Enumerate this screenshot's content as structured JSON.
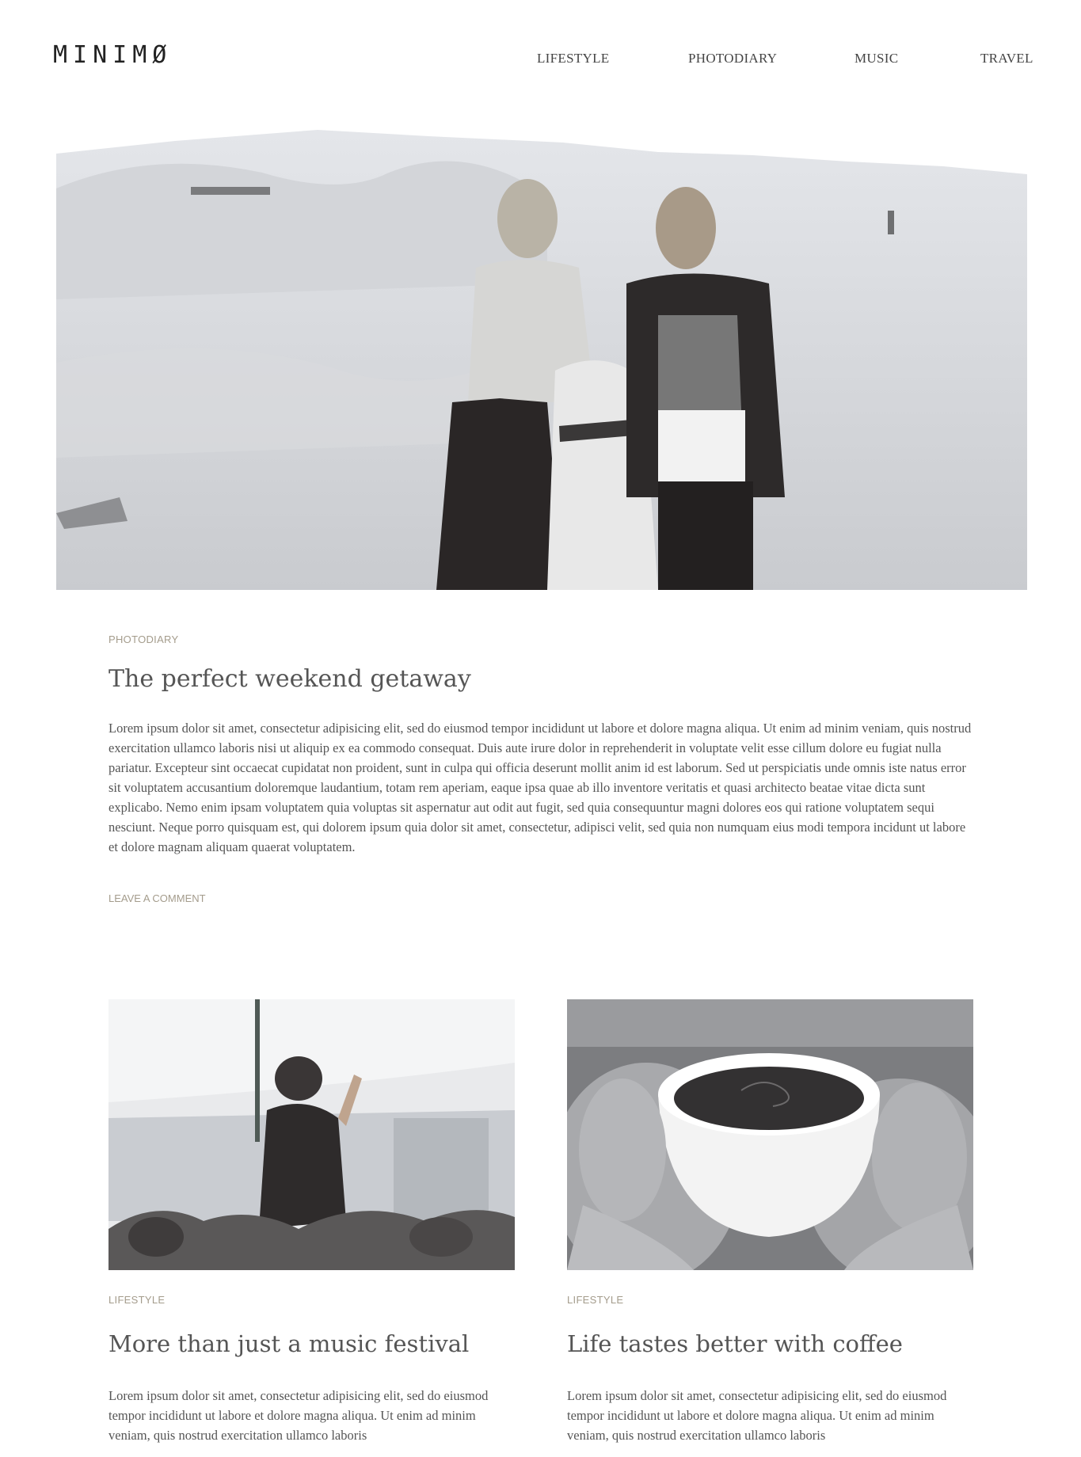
{
  "site": {
    "logo": "MINIMØ"
  },
  "nav": [
    "LIFESTYLE",
    "PHOTODIARY",
    "MUSIC",
    "TRAVEL"
  ],
  "featured_post": {
    "category": "PHOTODIARY",
    "title": "The perfect weekend getaway",
    "excerpt": "Lorem ipsum dolor sit amet, consectetur adipisicing elit, sed do eiusmod tempor incididunt ut labore et dolore magna aliqua. Ut enim ad minim veniam, quis nostrud exercitation ullamco laboris nisi ut aliquip ex ea commodo consequat. Duis aute irure dolor in reprehenderit in voluptate velit esse cillum dolore eu fugiat nulla pariatur. Excepteur sint occaecat cupidatat non proident, sunt in culpa qui officia deserunt mollit anim id est laborum. Sed ut perspiciatis unde omnis iste natus error sit voluptatem accusantium doloremque laudantium, totam rem aperiam, eaque ipsa quae ab illo inventore veritatis et quasi architecto beatae vitae dicta sunt explicabo. Nemo enim ipsam voluptatem quia voluptas sit aspernatur aut odit aut fugit, sed quia consequuntur magni dolores eos qui ratione voluptatem sequi nesciunt. Neque porro quisquam est, qui dolorem ipsum quia dolor sit amet, consectetur, adipisci velit, sed quia non numquam eius modi tempora incidunt ut labore et dolore magnam aliquam quaerat voluptatem.",
    "comment_link": "LEAVE A COMMENT"
  },
  "posts": [
    {
      "category": "LIFESTYLE",
      "title": "More than just a music festival",
      "excerpt": "Lorem ipsum dolor sit amet, consectetur adipisicing elit, sed do eiusmod tempor incididunt ut labore et dolore magna aliqua. Ut enim ad minim veniam, quis nostrud exercitation ullamco laboris"
    },
    {
      "category": "LIFESTYLE",
      "title": "Life tastes better with coffee",
      "excerpt": "Lorem ipsum dolor sit amet, consectetur adipisicing elit, sed do eiusmod tempor incididunt ut labore et dolore magna aliqua. Ut enim ad minim veniam, quis nostrud exercitation ullamco laboris"
    }
  ]
}
